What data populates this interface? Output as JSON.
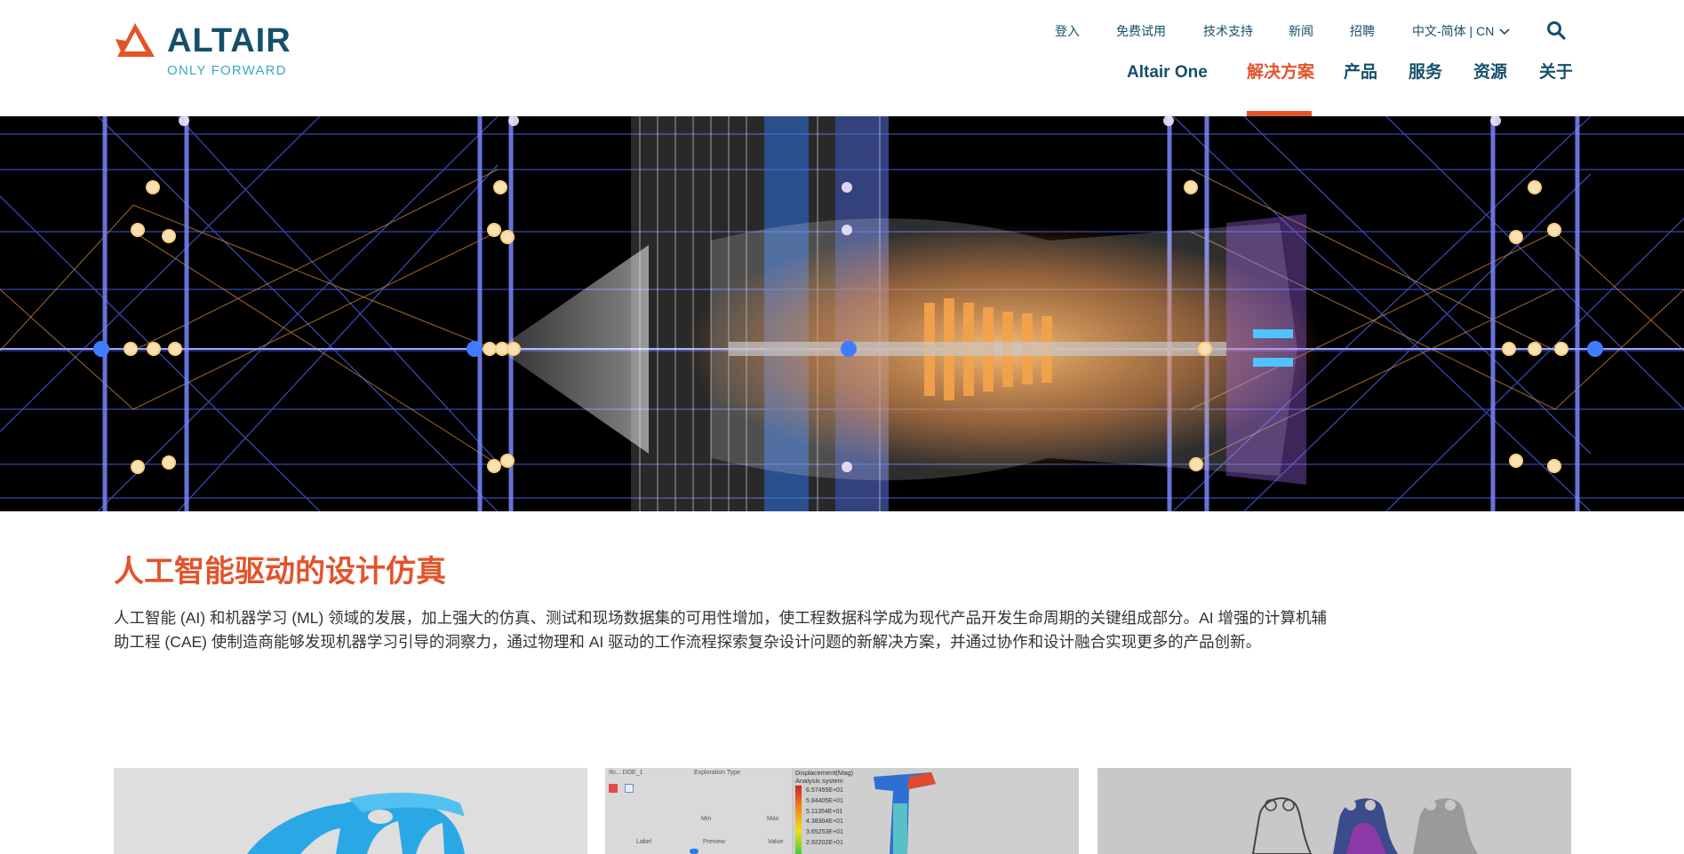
{
  "logo": {
    "wordmark": "ALTAIR",
    "tagline": "ONLY FORWARD"
  },
  "util_nav": {
    "login": "登入",
    "free_trial": "免费试用",
    "support": "技术支持",
    "news": "新闻",
    "careers": "招聘",
    "language": "中文-简体 | CN"
  },
  "main_nav": {
    "altair_one": "Altair One",
    "solutions": "解决方案",
    "products": "产品",
    "services": "服务",
    "resources": "资源",
    "about": "关于"
  },
  "content": {
    "title": "人工智能驱动的设计仿真",
    "description": "人工智能 (AI) 和机器学习 (ML) 领域的发展，加上强大的仿真、测试和现场数据集的可用性增加，使工程数据科学成为现代产品开发生命周期的关键组成部分。AI 增强的计算机辅助工程 (CAE) 使制造商能够发现机器学习引导的洞察力，通过物理和 AI 驱动的工作流程探索复杂设计问题的新解决方案，并通过协作和设计融合实现更多的产品创新。"
  },
  "cards": {
    "card2": {
      "panel_title": "Displacement(Mag)",
      "panel_subtitle": "Analysis system",
      "legend_values": [
        "6.57455E+01",
        "5.84405E+01",
        "5.11354E+01",
        "4.38304E+01",
        "3.65253E+01",
        "2.92202E+01"
      ],
      "tab_label": "Ifo... DOE_1",
      "field_label": "Exploration Type",
      "min_label": "Min",
      "max_label": "Max",
      "label_col": "Label",
      "preview_col": "Preview",
      "value_col": "Value"
    }
  },
  "colors": {
    "brand_dark": "#15506b",
    "accent": "#e3542a",
    "tagline": "#3aa8c0"
  }
}
